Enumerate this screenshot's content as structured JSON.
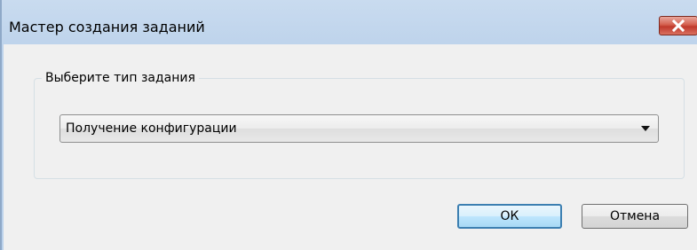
{
  "window": {
    "title": "Мастер создания заданий"
  },
  "group": {
    "label": "Выберите тип задания"
  },
  "task_type": {
    "selected": "Получение конфигурации"
  },
  "buttons": {
    "ok": "ОК",
    "cancel": "Отмена"
  },
  "colors": {
    "titlebar": "#c9dbef",
    "close_button": "#c0392b",
    "client_bg": "#f0f0f0",
    "default_button_border": "#3c7fb1"
  },
  "icons": {
    "close": "close-icon",
    "dropdown": "chevron-down-icon"
  }
}
